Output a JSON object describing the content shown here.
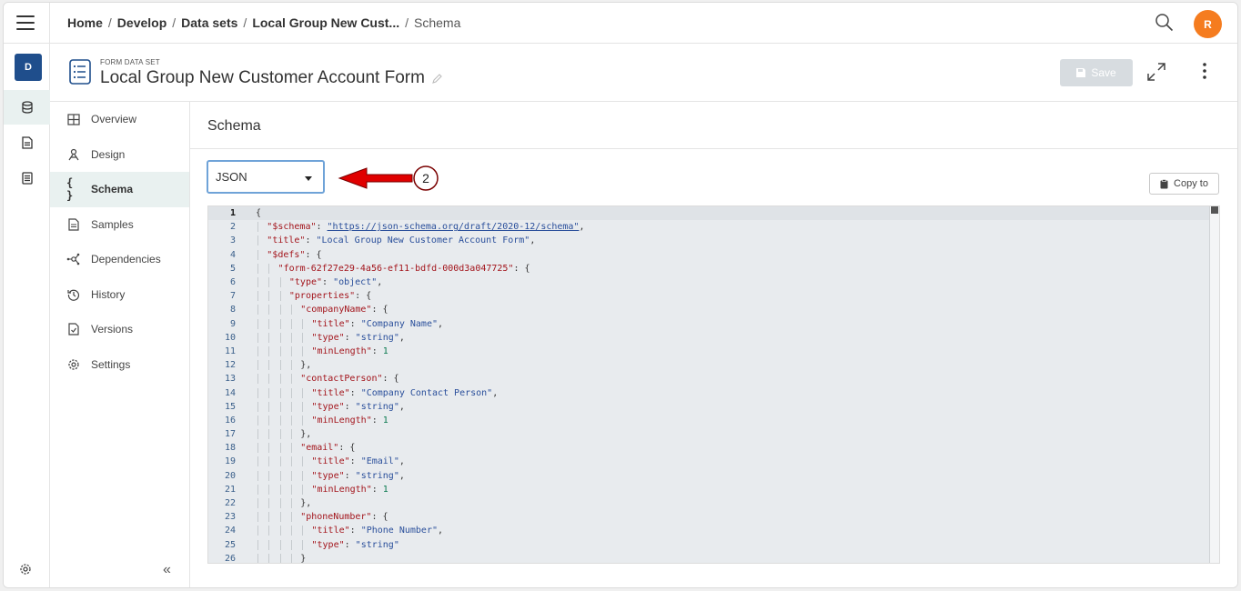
{
  "rail": {
    "workspace_badge": "D"
  },
  "breadcrumbs": {
    "home": "Home",
    "develop": "Develop",
    "datasets": "Data sets",
    "form": "Local Group New Cust...",
    "current": "Schema",
    "separator": "/"
  },
  "user": {
    "initial": "R",
    "avatar_color": "#f57c1f"
  },
  "header": {
    "caption": "FORM DATA SET",
    "title": "Local Group New Customer Account Form",
    "save_label": "Save"
  },
  "sidenav": {
    "items": [
      {
        "label": "Overview",
        "icon": "grid-icon"
      },
      {
        "label": "Design",
        "icon": "design-icon"
      },
      {
        "label": "Schema",
        "icon": "braces-icon"
      },
      {
        "label": "Samples",
        "icon": "document-icon"
      },
      {
        "label": "Dependencies",
        "icon": "graph-icon"
      },
      {
        "label": "History",
        "icon": "history-icon"
      },
      {
        "label": "Versions",
        "icon": "versions-icon"
      },
      {
        "label": "Settings",
        "icon": "gear-icon"
      }
    ],
    "active": "Schema",
    "collapse_label": "«"
  },
  "main": {
    "section_title": "Schema",
    "format_select": {
      "value": "JSON"
    },
    "annotation_number": "2",
    "copy_label": "Copy to"
  },
  "colors": {
    "accent": "#1f4e8c",
    "active_bg": "#e9f1f0",
    "arrow": "#e00000",
    "json_key": "#a3151c",
    "json_string": "#2a4f9b",
    "json_number": "#0b7a50"
  },
  "code_lines": [
    {
      "n": "1",
      "indent": 0,
      "parts": [
        [
          "p",
          "{"
        ]
      ]
    },
    {
      "n": "2",
      "indent": 1,
      "parts": [
        [
          "k",
          "\"$schema\""
        ],
        [
          "p",
          ": "
        ],
        [
          "u",
          "\"https://json-schema.org/draft/2020-12/schema\""
        ],
        [
          "p",
          ","
        ]
      ]
    },
    {
      "n": "3",
      "indent": 1,
      "parts": [
        [
          "k",
          "\"title\""
        ],
        [
          "p",
          ": "
        ],
        [
          "s",
          "\"Local Group New Customer Account Form\""
        ],
        [
          "p",
          ","
        ]
      ]
    },
    {
      "n": "4",
      "indent": 1,
      "parts": [
        [
          "k",
          "\"$defs\""
        ],
        [
          "p",
          ": {"
        ]
      ]
    },
    {
      "n": "5",
      "indent": 2,
      "parts": [
        [
          "k",
          "\"form-62f27e29-4a56-ef11-bdfd-000d3a047725\""
        ],
        [
          "p",
          ": {"
        ]
      ]
    },
    {
      "n": "6",
      "indent": 3,
      "parts": [
        [
          "k",
          "\"type\""
        ],
        [
          "p",
          ": "
        ],
        [
          "s",
          "\"object\""
        ],
        [
          "p",
          ","
        ]
      ]
    },
    {
      "n": "7",
      "indent": 3,
      "parts": [
        [
          "k",
          "\"properties\""
        ],
        [
          "p",
          ": {"
        ]
      ]
    },
    {
      "n": "8",
      "indent": 4,
      "parts": [
        [
          "k",
          "\"companyName\""
        ],
        [
          "p",
          ": {"
        ]
      ]
    },
    {
      "n": "9",
      "indent": 5,
      "parts": [
        [
          "k",
          "\"title\""
        ],
        [
          "p",
          ": "
        ],
        [
          "s",
          "\"Company Name\""
        ],
        [
          "p",
          ","
        ]
      ]
    },
    {
      "n": "10",
      "indent": 5,
      "parts": [
        [
          "k",
          "\"type\""
        ],
        [
          "p",
          ": "
        ],
        [
          "s",
          "\"string\""
        ],
        [
          "p",
          ","
        ]
      ]
    },
    {
      "n": "11",
      "indent": 5,
      "parts": [
        [
          "k",
          "\"minLength\""
        ],
        [
          "p",
          ": "
        ],
        [
          "d",
          "1"
        ]
      ]
    },
    {
      "n": "12",
      "indent": 4,
      "parts": [
        [
          "p",
          "},"
        ]
      ]
    },
    {
      "n": "13",
      "indent": 4,
      "parts": [
        [
          "k",
          "\"contactPerson\""
        ],
        [
          "p",
          ": {"
        ]
      ]
    },
    {
      "n": "14",
      "indent": 5,
      "parts": [
        [
          "k",
          "\"title\""
        ],
        [
          "p",
          ": "
        ],
        [
          "s",
          "\"Company Contact Person\""
        ],
        [
          "p",
          ","
        ]
      ]
    },
    {
      "n": "15",
      "indent": 5,
      "parts": [
        [
          "k",
          "\"type\""
        ],
        [
          "p",
          ": "
        ],
        [
          "s",
          "\"string\""
        ],
        [
          "p",
          ","
        ]
      ]
    },
    {
      "n": "16",
      "indent": 5,
      "parts": [
        [
          "k",
          "\"minLength\""
        ],
        [
          "p",
          ": "
        ],
        [
          "d",
          "1"
        ]
      ]
    },
    {
      "n": "17",
      "indent": 4,
      "parts": [
        [
          "p",
          "},"
        ]
      ]
    },
    {
      "n": "18",
      "indent": 4,
      "parts": [
        [
          "k",
          "\"email\""
        ],
        [
          "p",
          ": {"
        ]
      ]
    },
    {
      "n": "19",
      "indent": 5,
      "parts": [
        [
          "k",
          "\"title\""
        ],
        [
          "p",
          ": "
        ],
        [
          "s",
          "\"Email\""
        ],
        [
          "p",
          ","
        ]
      ]
    },
    {
      "n": "20",
      "indent": 5,
      "parts": [
        [
          "k",
          "\"type\""
        ],
        [
          "p",
          ": "
        ],
        [
          "s",
          "\"string\""
        ],
        [
          "p",
          ","
        ]
      ]
    },
    {
      "n": "21",
      "indent": 5,
      "parts": [
        [
          "k",
          "\"minLength\""
        ],
        [
          "p",
          ": "
        ],
        [
          "d",
          "1"
        ]
      ]
    },
    {
      "n": "22",
      "indent": 4,
      "parts": [
        [
          "p",
          "},"
        ]
      ]
    },
    {
      "n": "23",
      "indent": 4,
      "parts": [
        [
          "k",
          "\"phoneNumber\""
        ],
        [
          "p",
          ": {"
        ]
      ]
    },
    {
      "n": "24",
      "indent": 5,
      "parts": [
        [
          "k",
          "\"title\""
        ],
        [
          "p",
          ": "
        ],
        [
          "s",
          "\"Phone Number\""
        ],
        [
          "p",
          ","
        ]
      ]
    },
    {
      "n": "25",
      "indent": 5,
      "parts": [
        [
          "k",
          "\"type\""
        ],
        [
          "p",
          ": "
        ],
        [
          "s",
          "\"string\""
        ]
      ]
    },
    {
      "n": "26",
      "indent": 4,
      "parts": [
        [
          "p",
          "}"
        ]
      ]
    }
  ]
}
